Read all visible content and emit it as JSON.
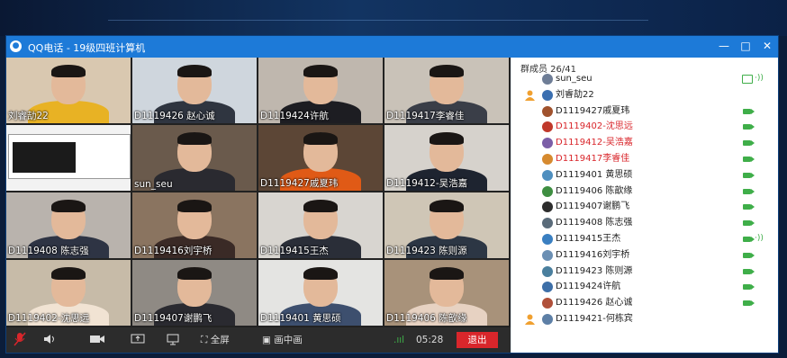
{
  "window": {
    "title": "QQ电话 - 19级四班计算机",
    "min": "—",
    "max": "□",
    "close": "✕"
  },
  "tiles": [
    {
      "label": "刘睿劼22"
    },
    {
      "label": "D1119426 赵心诚"
    },
    {
      "label": "D1119424许航"
    },
    {
      "label": "D1119417李睿佳"
    },
    {
      "label": ""
    },
    {
      "label": "sun_seu"
    },
    {
      "label": "D1119427戚夏玮"
    },
    {
      "label": "D1119412-吴浩嘉"
    },
    {
      "label": "D1119408 陈志强"
    },
    {
      "label": "D1119416刘宇桥"
    },
    {
      "label": "D1119415王杰"
    },
    {
      "label": "D1119423 陈则源"
    },
    {
      "label": "D1119402-沈思远"
    },
    {
      "label": "D1119407谢鹏飞"
    },
    {
      "label": "D1119401 黄思硕"
    },
    {
      "label": "D1119406 陈歆缘"
    }
  ],
  "controls": {
    "fullscreen": "全屏",
    "pip": "画中画",
    "time": "05:28",
    "exit": "退出"
  },
  "sidebar": {
    "count_label": "群成员 26/41",
    "members": [
      {
        "name": "sun_seu",
        "color": "#222",
        "lead": false,
        "media": "screen"
      },
      {
        "name": "刘睿劼22",
        "color": "#222",
        "lead": true,
        "media": "none"
      },
      {
        "name": "D1119427戚夏玮",
        "color": "#222",
        "lead": false,
        "media": "cam"
      },
      {
        "name": "D1119402-沈思远",
        "color": "#d9262b",
        "lead": false,
        "media": "cam"
      },
      {
        "name": "D1119412-吴浩嘉",
        "color": "#d9262b",
        "lead": false,
        "media": "cam"
      },
      {
        "name": "D1119417李睿佳",
        "color": "#d9262b",
        "lead": false,
        "media": "cam"
      },
      {
        "name": "D1119401 黄思硕",
        "color": "#222",
        "lead": false,
        "media": "cam"
      },
      {
        "name": "D1119406 陈歆缘",
        "color": "#222",
        "lead": false,
        "media": "cam"
      },
      {
        "name": "D1119407谢鹏飞",
        "color": "#222",
        "lead": false,
        "media": "cam"
      },
      {
        "name": "D1119408 陈志强",
        "color": "#222",
        "lead": false,
        "media": "cam"
      },
      {
        "name": "D1119415王杰",
        "color": "#222",
        "lead": false,
        "media": "cam-mic"
      },
      {
        "name": "D1119416刘宇桥",
        "color": "#222",
        "lead": false,
        "media": "cam"
      },
      {
        "name": "D1119423 陈则源",
        "color": "#222",
        "lead": false,
        "media": "cam"
      },
      {
        "name": "D1119424许航",
        "color": "#222",
        "lead": false,
        "media": "cam"
      },
      {
        "name": "D1119426 赵心诚",
        "color": "#222",
        "lead": false,
        "media": "cam"
      },
      {
        "name": "D1119421-何栋宾",
        "color": "#222",
        "lead": true,
        "media": "none"
      }
    ]
  },
  "colors": {
    "accent": "#1d7ad8",
    "camera": "#3fae49",
    "exit": "#d9262b",
    "highlight": "#d9262b"
  }
}
